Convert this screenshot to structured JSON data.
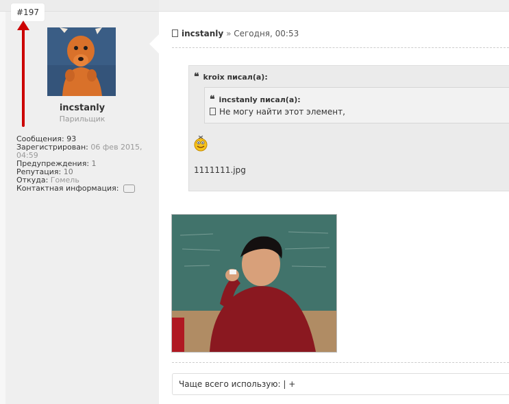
{
  "post": {
    "number": "#197",
    "author": "incstanly",
    "separator": "»",
    "date": "Сегодня, 00:53",
    "file_name": "1111111.jpg",
    "signature": "Чаще всего использую: | +"
  },
  "user": {
    "name": "incstanly",
    "title": "Парильщик",
    "stats": {
      "messages_label": "Сообщения:",
      "messages_value": "93",
      "registered_label": "Зарегистрирован:",
      "registered_value": "06 фев 2015,",
      "registered_time": "04:59",
      "warnings_label": "Предупреждения:",
      "warnings_value": "1",
      "reputation_label": "Репутация:",
      "reputation_value": "10",
      "from_label": "Откуда:",
      "from_value": "Гомель",
      "contact_label": "Контактная информация:"
    }
  },
  "quote": {
    "outer_title": "kroix писал(а):",
    "inner_title": "incstanly писал(а):",
    "inner_text": "Не могу найти этот элемент,"
  },
  "icons": {
    "quote": "quote-marks-icon",
    "document": "document-icon",
    "smiley": "smiley-icon",
    "contact": "chat-bubble-icon"
  },
  "colors": {
    "annotation_arrow": "#cc0000",
    "user_panel": "#efefef",
    "quote_bg": "#ebebeb"
  }
}
